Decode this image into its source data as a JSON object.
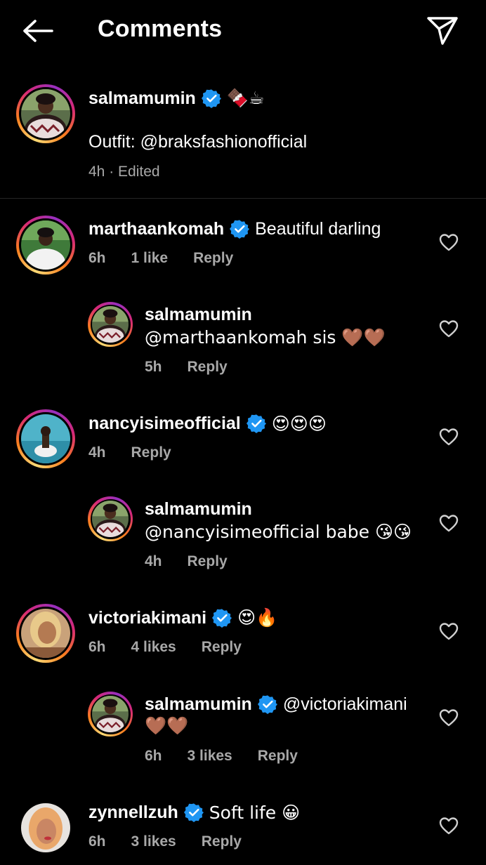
{
  "header": {
    "title": "Comments"
  },
  "caption": {
    "username": "salmamumin",
    "emojis": "🍫☕",
    "text": "Outfit:  @braksfashionofficial",
    "time": "4h",
    "edited": "Edited"
  },
  "comments": [
    {
      "username": "marthaankomah",
      "text": "Beautiful darling",
      "time": "6h",
      "likes": "1 like",
      "reply": "Reply"
    },
    {
      "username": "salmamumin",
      "text": "@marthaankomah sis 🤎🤎",
      "time": "5h",
      "reply": "Reply"
    },
    {
      "username": "nancyisimeofficial",
      "text": "😍😍😍",
      "time": "4h",
      "reply": "Reply"
    },
    {
      "username": "salmamumin",
      "text": "@nancyisimeofficial babe 😘😘",
      "time": "4h",
      "reply": "Reply"
    },
    {
      "username": "victoriakimani",
      "text": "😍🔥",
      "time": "6h",
      "likes": "4 likes",
      "reply": "Reply"
    },
    {
      "username": "salmamumin",
      "text": "@victoriakimani",
      "text2": "🤎🤎",
      "time": "6h",
      "likes": "3 likes",
      "reply": "Reply"
    },
    {
      "username": "zynnellzuh",
      "text": "Soft life 😀",
      "time": "6h",
      "likes": "3 likes",
      "reply": "Reply"
    }
  ],
  "icons": [
    "back-arrow-icon",
    "send-icon",
    "verified-badge-icon",
    "heart-outline-icon"
  ],
  "colors": {
    "background": "#000000",
    "secondary_text": "#a8a8a8",
    "verified": "#1f96f3"
  }
}
